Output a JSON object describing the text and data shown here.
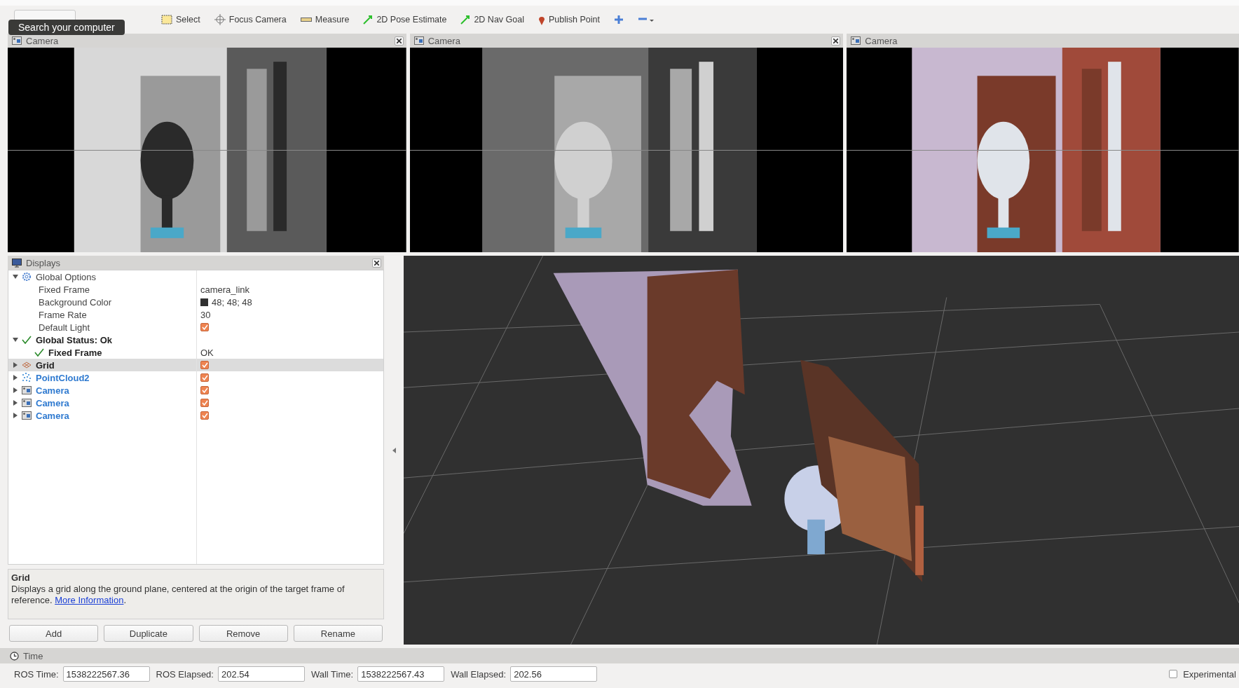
{
  "toolbar": {
    "tools": [
      {
        "kind": "interact"
      },
      {
        "kind": "select",
        "label": "Select"
      },
      {
        "kind": "focus",
        "label": "Focus Camera"
      },
      {
        "kind": "measure",
        "label": "Measure"
      },
      {
        "kind": "pose",
        "label": "2D Pose Estimate"
      },
      {
        "kind": "nav",
        "label": "2D Nav Goal"
      },
      {
        "kind": "point",
        "label": "Publish Point"
      },
      {
        "kind": "plus"
      },
      {
        "kind": "minus"
      }
    ],
    "tooltip": "Search your computer"
  },
  "camera_panels": [
    {
      "title": "Camera"
    },
    {
      "title": "Camera"
    },
    {
      "title": "Camera"
    }
  ],
  "displays": {
    "title": "Displays",
    "tree": [
      {
        "kind": "options",
        "label": "Global Options",
        "expanded": true,
        "children": [
          {
            "kind": "property",
            "label": "Fixed Frame",
            "value": "camera_link"
          },
          {
            "kind": "property",
            "label": "Background Color",
            "value": "48; 48; 48",
            "color": "#303030"
          },
          {
            "kind": "property",
            "label": "Frame Rate",
            "value": "30"
          },
          {
            "kind": "property",
            "label": "Default Light",
            "checked": true
          }
        ]
      },
      {
        "kind": "status",
        "label": "Global Status: Ok",
        "expanded": true,
        "children": [
          {
            "kind": "status",
            "label": "Fixed Frame",
            "value": "OK"
          }
        ]
      },
      {
        "kind": "grid",
        "label": "Grid",
        "expanded": false,
        "checked": true,
        "selected": true
      },
      {
        "kind": "pointcloud",
        "label": "PointCloud2",
        "expanded": false,
        "checked": true,
        "selected": false
      },
      {
        "kind": "camera",
        "label": "Camera",
        "expanded": false,
        "checked": true,
        "selected": false
      },
      {
        "kind": "camera",
        "label": "Camera",
        "expanded": false,
        "checked": true,
        "selected": false
      },
      {
        "kind": "camera",
        "label": "Camera",
        "expanded": false,
        "checked": true,
        "selected": false
      }
    ],
    "description": {
      "title": "Grid",
      "text": "Displays a grid along the ground plane, centered at the origin of the target frame of reference.",
      "link": "More Information",
      "tail": "."
    },
    "buttons": [
      "Add",
      "Duplicate",
      "Remove",
      "Rename"
    ]
  },
  "time": {
    "title": "Time",
    "fields": [
      {
        "label": "ROS Time:",
        "value": "1538222567.36"
      },
      {
        "label": "ROS Elapsed:",
        "value": "202.54"
      },
      {
        "label": "Wall Time:",
        "value": "1538222567.43"
      },
      {
        "label": "Wall Elapsed:",
        "value": "202.56"
      }
    ],
    "experimental": {
      "label": "Experimental",
      "checked": false
    }
  }
}
